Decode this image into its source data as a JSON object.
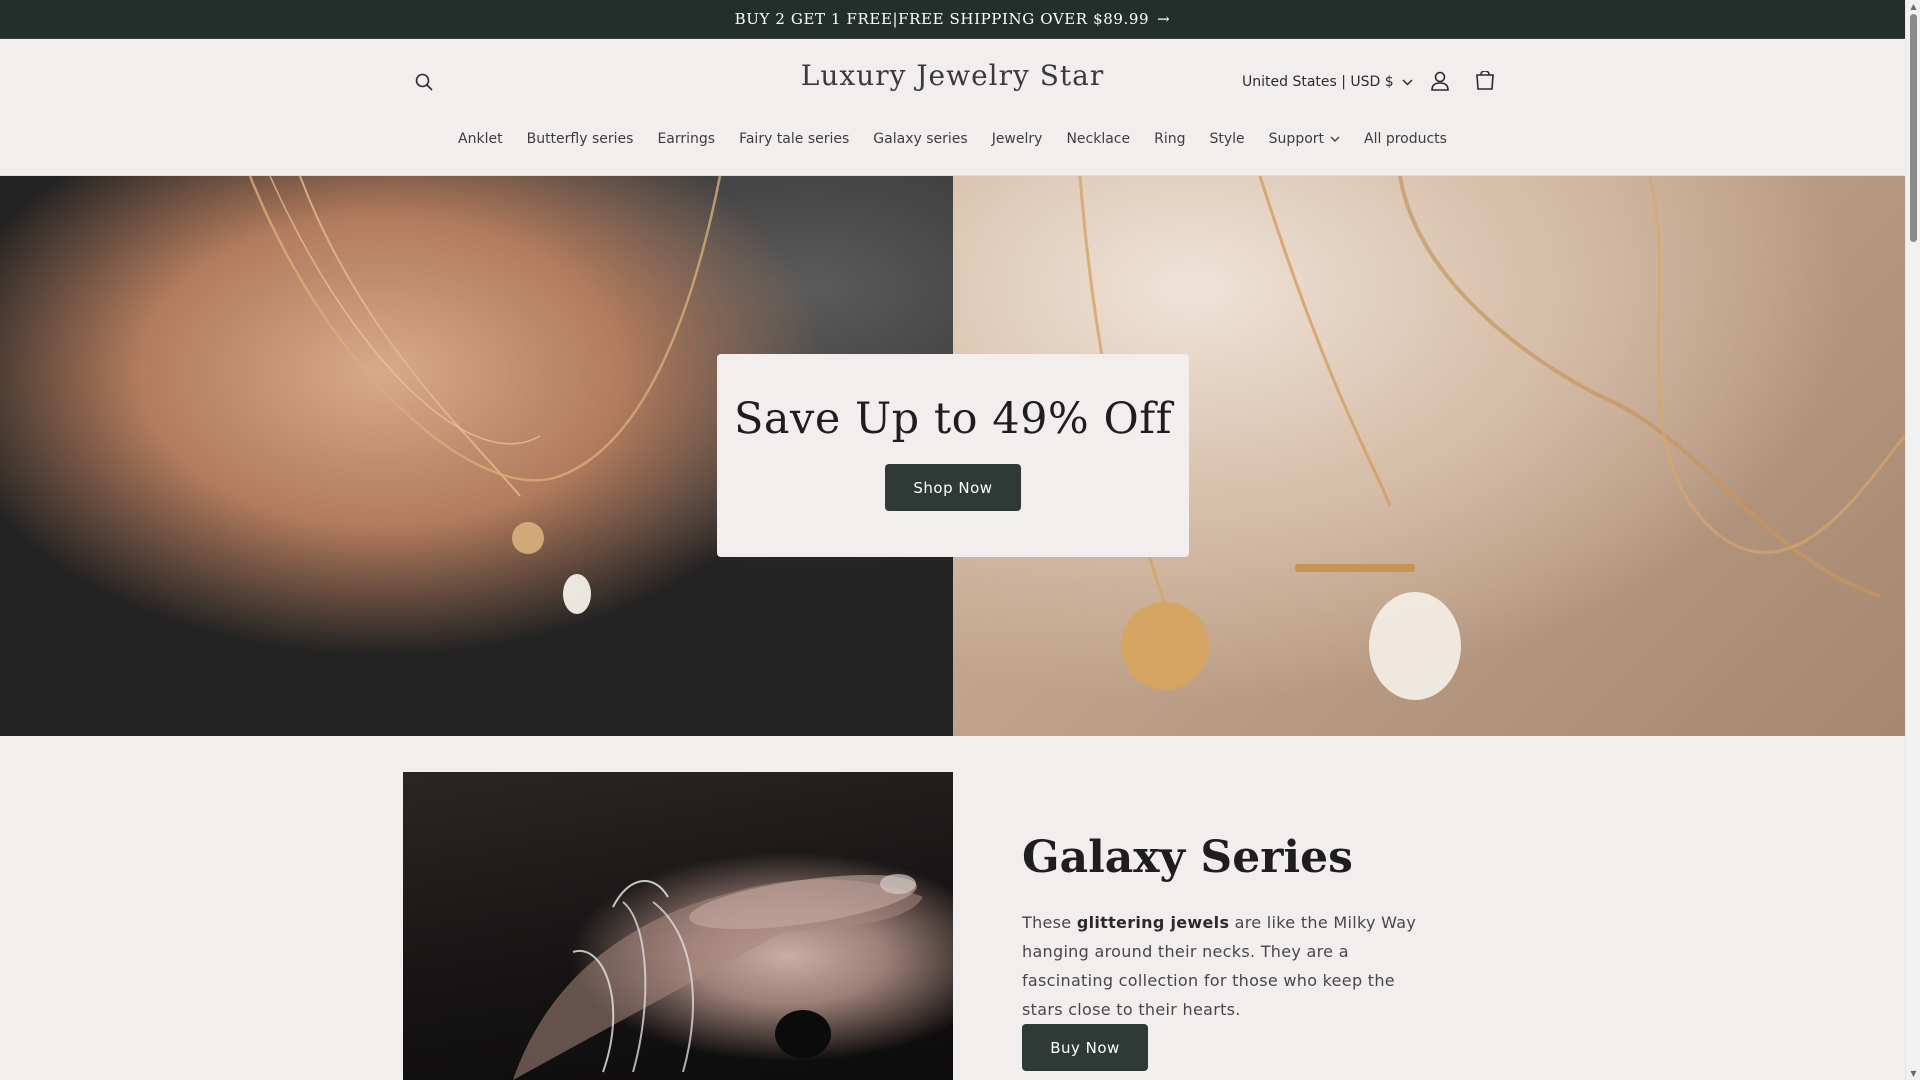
{
  "announcement": {
    "text": "BUY 2 GET 1 FREE|FREE SHIPPING OVER $89.99",
    "arrow": "→"
  },
  "header": {
    "logo": "Luxury Jewelry Star",
    "locale": "United States | USD $",
    "icons": {
      "search": "search-icon",
      "account": "account-icon",
      "cart": "cart-icon",
      "locale_caret": "chevron-down-icon"
    }
  },
  "nav": {
    "items": [
      {
        "label": "Anklet"
      },
      {
        "label": "Butterfly series"
      },
      {
        "label": "Earrings"
      },
      {
        "label": "Fairy tale series"
      },
      {
        "label": "Galaxy series"
      },
      {
        "label": "Jewelry"
      },
      {
        "label": "Necklace"
      },
      {
        "label": "Ring"
      },
      {
        "label": "Style"
      },
      {
        "label": "Support",
        "has_dropdown": true
      },
      {
        "label": "All products"
      }
    ]
  },
  "hero": {
    "title": "Save Up to 49% Off",
    "button": "Shop Now"
  },
  "feature": {
    "title": "Galaxy Series",
    "text_before": "These ",
    "text_bold": "glittering jewels",
    "text_after": " are like the Milky Way hanging around their necks. They are a fascinating collection for those who keep the stars close to their hearts.",
    "button": "Buy Now"
  },
  "colors": {
    "announcement_bg": "#242f2c",
    "page_bg": "#f3eeee",
    "button_bg": "#2f3a37",
    "button_text": "#ffffff"
  }
}
